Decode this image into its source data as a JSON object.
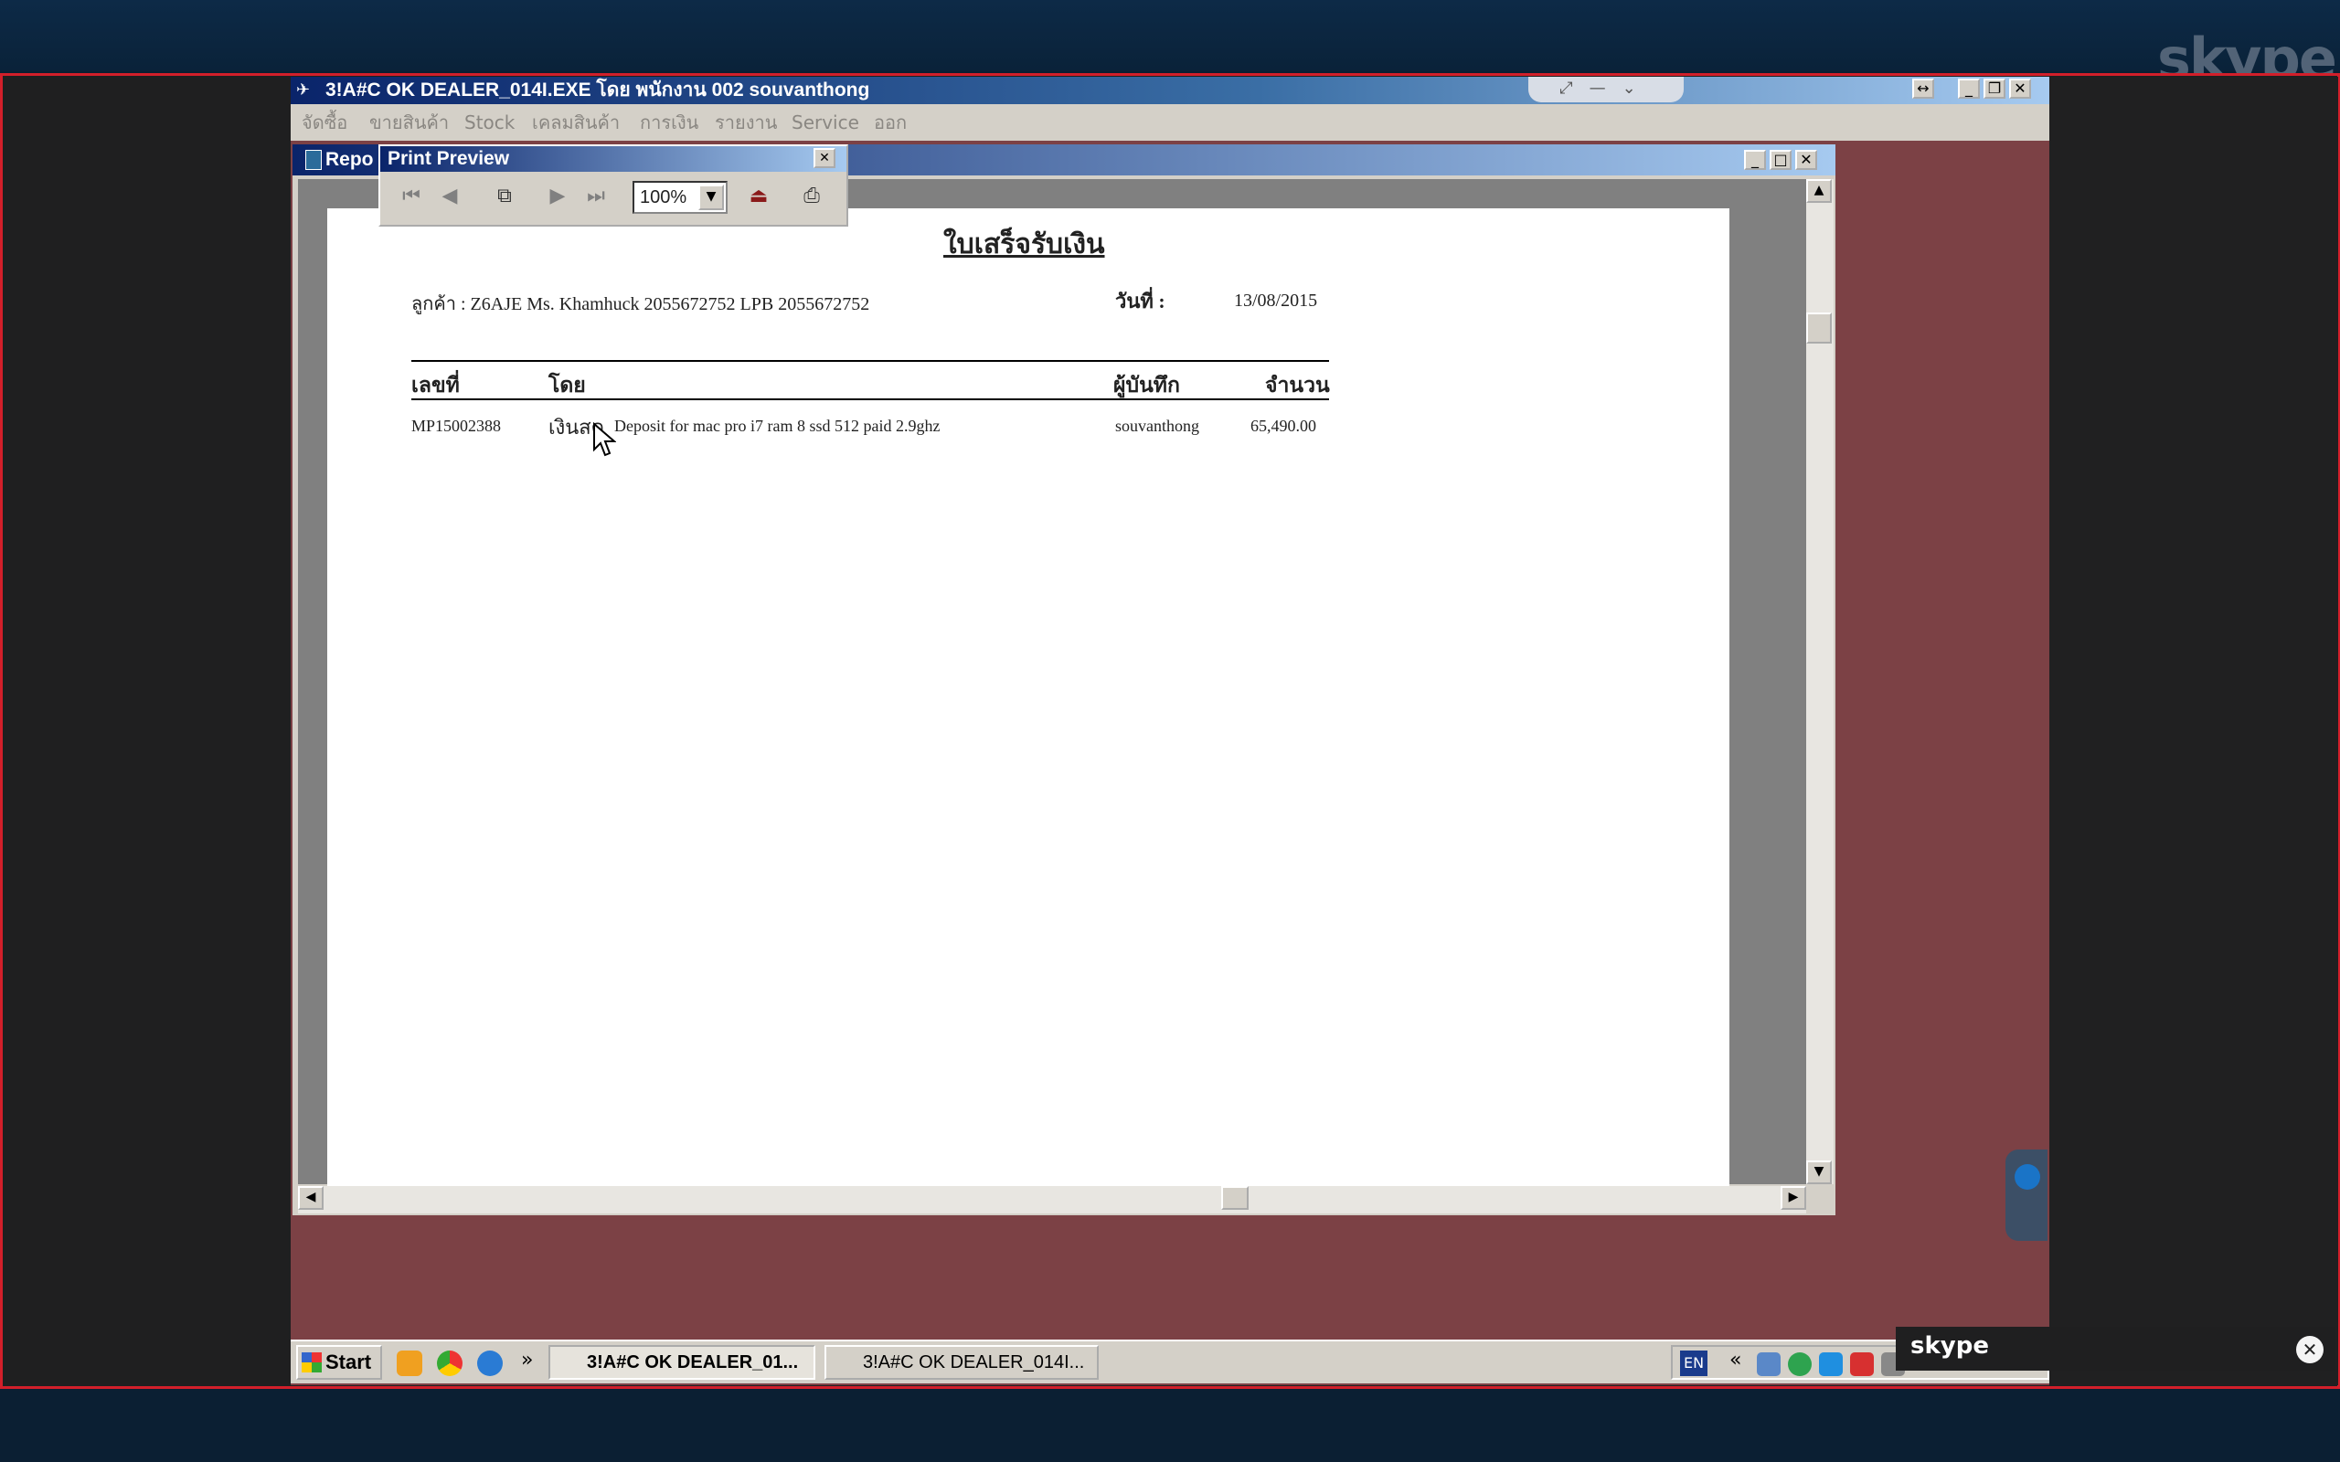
{
  "skype": {
    "logo_text": "skype",
    "mini_logo_text": "skype",
    "close_glyph": "✕"
  },
  "app": {
    "title": "3!A#C OK DEALER_014I.EXE โดย พนักงาน 002 souvanthong",
    "menu": [
      "จัดซื้อ",
      "ขายสินค้า",
      "Stock",
      "เคลมสินค้า",
      "การเงิน",
      "รายงาน",
      "Service",
      "ออก"
    ]
  },
  "report_window": {
    "title": "Repo"
  },
  "print_preview": {
    "title": "Print Preview",
    "zoom": "100%",
    "tools": [
      "first-page-icon",
      "prev-page-icon",
      "multi-page-icon",
      "next-page-icon",
      "last-page-icon",
      "close-preview-icon",
      "printer-icon"
    ]
  },
  "document": {
    "title": "ใบเสร็จรับเงิน",
    "customer": "ลูกค้า : Z6AJE Ms. Khamhuck 2055672752 LPB 2055672752",
    "date_label": "วันที่ :",
    "date": "13/08/2015",
    "columns": [
      "เลขที่",
      "โดย",
      "ผู้บันทึก",
      "จำนวน"
    ],
    "rows": [
      {
        "number": "MP15002388",
        "method": "เงินสด",
        "description": "Deposit for mac pro i7 ram 8 ssd 512 paid 2.9ghz",
        "recorder": "souvanthong",
        "amount": "65,490.00"
      }
    ]
  },
  "taskbar": {
    "start": "Start",
    "tasks": [
      "3!A#C OK DEALER_01...",
      "3!A#C OK DEALER_014I..."
    ],
    "chevron": "»",
    "tray_chevron": "«",
    "lang": "EN"
  }
}
